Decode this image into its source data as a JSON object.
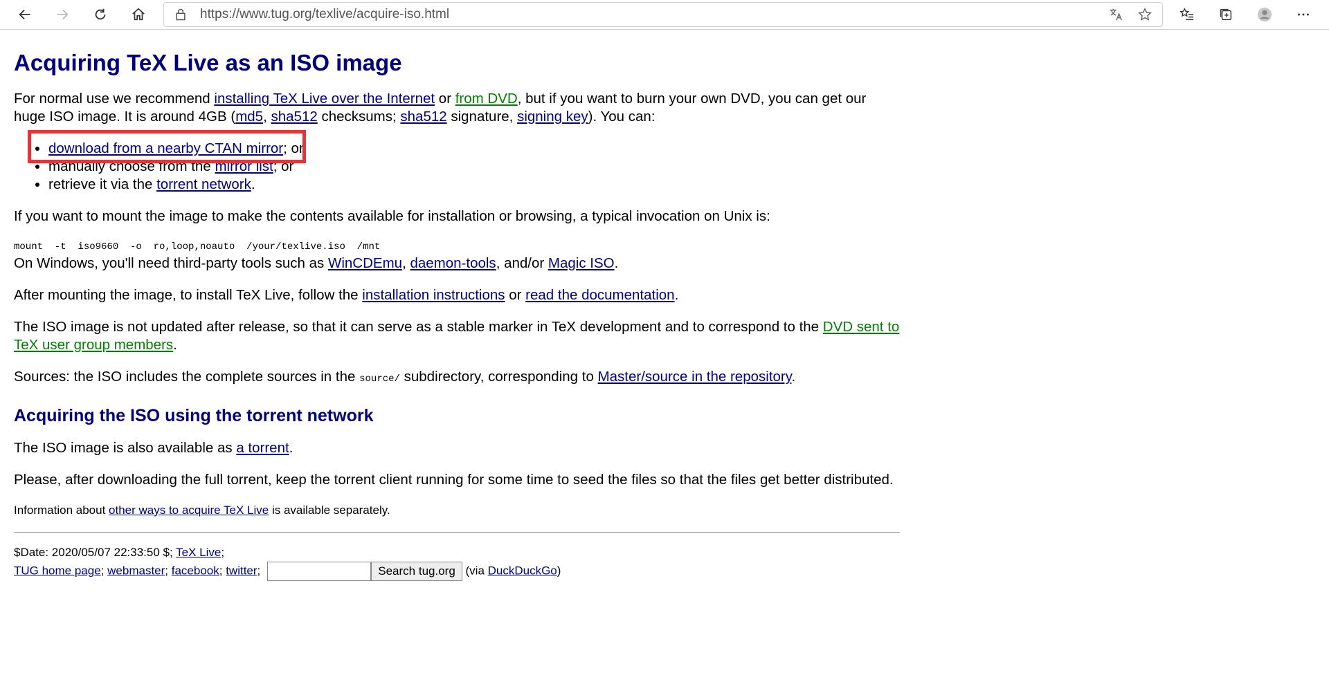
{
  "browser": {
    "url": "https://www.tug.org/texlive/acquire-iso.html",
    "icons": [
      "back-icon",
      "forward-icon",
      "refresh-icon",
      "home-icon",
      "lock-icon",
      "translate-icon",
      "favorite-star-icon",
      "favorites-list-icon",
      "collections-icon",
      "profile-icon",
      "more-icon"
    ]
  },
  "page": {
    "title": "Acquiring TeX Live as an ISO image",
    "intro": {
      "t1": "For normal use we recommend ",
      "l1": "installing TeX Live over the Internet",
      "t2": " or ",
      "l2": "from DVD",
      "t3": ", but if you want to burn your own DVD, you can get our huge ISO image. It is around 4GB (",
      "l3": "md5",
      "t4": ", ",
      "l4": "sha512",
      "t5": " checksums; ",
      "l5": "sha512",
      "t6": " signature, ",
      "l6": "signing key",
      "t7": "). You can:"
    },
    "options": [
      {
        "link": "download from a nearby CTAN mirror",
        "prefix": "",
        "suffix": "; or"
      },
      {
        "link": "mirror list",
        "prefix": "manually choose from the ",
        "suffix": "; or"
      },
      {
        "link": "torrent network",
        "prefix": "retrieve it via the ",
        "suffix": "."
      }
    ],
    "mount": {
      "text": "If you want to mount the image to make the contents available for installation or browsing, a typical invocation on Unix is:",
      "cmd": "mount  -t  iso9660  -o  ro,loop,noauto  /your/texlive.iso  /mnt",
      "win_t1": "On Windows, you'll need third-party tools such as ",
      "win_l1": "WinCDEmu",
      "win_t2": ", ",
      "win_l2": "daemon-tools",
      "win_t3": ", and/or ",
      "win_l3": "Magic ISO",
      "win_t4": "."
    },
    "after": {
      "t1": "After mounting the image, to install TeX Live, follow the ",
      "l1": "installation instructions",
      "t2": " or ",
      "l2": "read the documentation",
      "t3": "."
    },
    "iso_note": {
      "t1": "The ISO image is not updated after release, so that it can serve as a stable marker in TeX development and to correspond to the ",
      "l1": "DVD sent to TeX user group members",
      "t2": "."
    },
    "sources": {
      "t1": "Sources: the ISO includes the complete sources in the ",
      "code": "source/",
      "t2": " subdirectory, corresponding to ",
      "l1": "Master/source in the repository",
      "t3": "."
    },
    "torrent_heading": "Acquiring the ISO using the torrent network",
    "torrent_p1": {
      "t1": "The ISO image is also available as ",
      "l1": "a torrent",
      "t2": "."
    },
    "torrent_p2": "Please, after downloading the full torrent, keep the torrent client running for some time to seed the files so that the files get better distributed.",
    "info": {
      "t1": "Information about ",
      "l1": "other ways to acquire TeX Live",
      "t2": " is available separately."
    },
    "footer": {
      "date": "$Date: 2020/05/07 22:33:50 $; ",
      "texlive": "TeX Live",
      "sep0": ";",
      "tug": "TUG home page",
      "sep1": "; ",
      "webmaster": "webmaster",
      "sep2": "; ",
      "facebook": "facebook",
      "sep3": "; ",
      "twitter": "twitter",
      "sep4": ";",
      "search_value": "",
      "search_button": "Search tug.org",
      "via_t1": " (via ",
      "via_link": "DuckDuckGo",
      "via_t2": ")"
    }
  }
}
